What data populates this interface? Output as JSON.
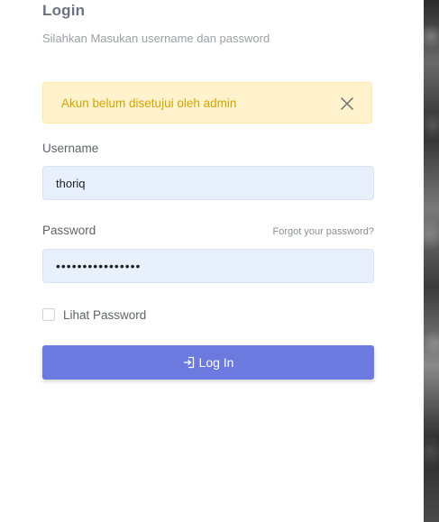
{
  "header": {
    "title": "Login",
    "subtitle": "Silahkan Masukan username dan password"
  },
  "alert": {
    "message": "Akun belum disetujui oleh admin",
    "close_icon": "close-icon",
    "color": "#d4a300",
    "background": "#fff3cd"
  },
  "form": {
    "username_label": "Username",
    "username_value": "thoriq",
    "password_label": "Password",
    "forgot_password": "Forgot your password?",
    "password_value": "thoriq123456789x",
    "show_password_label": "Lihat Password",
    "show_password_checked": false,
    "login_button": "Log In",
    "login_icon": "sign-in-icon",
    "accent_color": "#6c7ae0"
  }
}
